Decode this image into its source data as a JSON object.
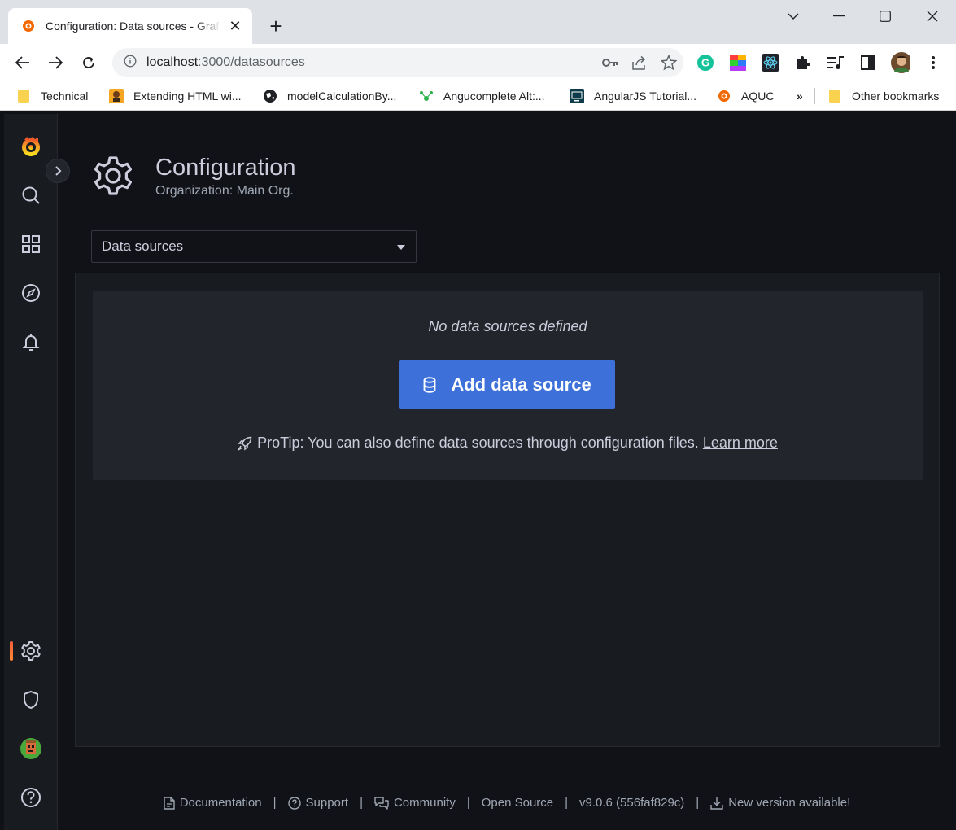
{
  "browser": {
    "tab_title": "Configuration: Data sources - Grafana",
    "tab_close": "✕",
    "new_tab": "+",
    "url_host": "localhost",
    "url_path": ":3000/datasources",
    "bookmarks": [
      {
        "label": "Technical",
        "icon": "folder-icon"
      },
      {
        "label": "Extending HTML wi...",
        "icon": "extending-html-favicon"
      },
      {
        "label": "modelCalculationBy...",
        "icon": "globe-favicon"
      },
      {
        "label": "Angucomplete Alt:...",
        "icon": "angucomplete-favicon"
      },
      {
        "label": "AngularJS Tutorial...",
        "icon": "angularjs-tutorial-favicon"
      },
      {
        "label": "AQUC",
        "icon": "grafana-favicon"
      },
      {
        "label": "»",
        "icon": ""
      },
      {
        "label": "Other bookmarks",
        "icon": "folder-icon"
      }
    ]
  },
  "colors": {
    "accent_orange": "#f55f3e",
    "primary_blue": "#3d71d9",
    "background": "#111217",
    "panel": "#181b1f",
    "card": "#22252b"
  },
  "sidemenu": {
    "items": [
      "grafana-logo",
      "search",
      "dashboards",
      "explore",
      "alerting",
      "configuration",
      "server-admin",
      "profile",
      "help"
    ],
    "active": "configuration"
  },
  "header": {
    "title": "Configuration",
    "subtitle": "Organization: Main Org."
  },
  "nav_select": {
    "value": "Data sources"
  },
  "empty_state": {
    "title": "No data sources defined",
    "button_label": "Add data source",
    "protip": "ProTip: You can also define data sources through configuration files.",
    "learn_more": "Learn more"
  },
  "footer": {
    "documentation": "Documentation",
    "support": "Support",
    "community": "Community",
    "open_source": "Open Source",
    "version": "v9.0.6 (556faf829c)",
    "new_version": "New version available!",
    "separator": "|"
  }
}
